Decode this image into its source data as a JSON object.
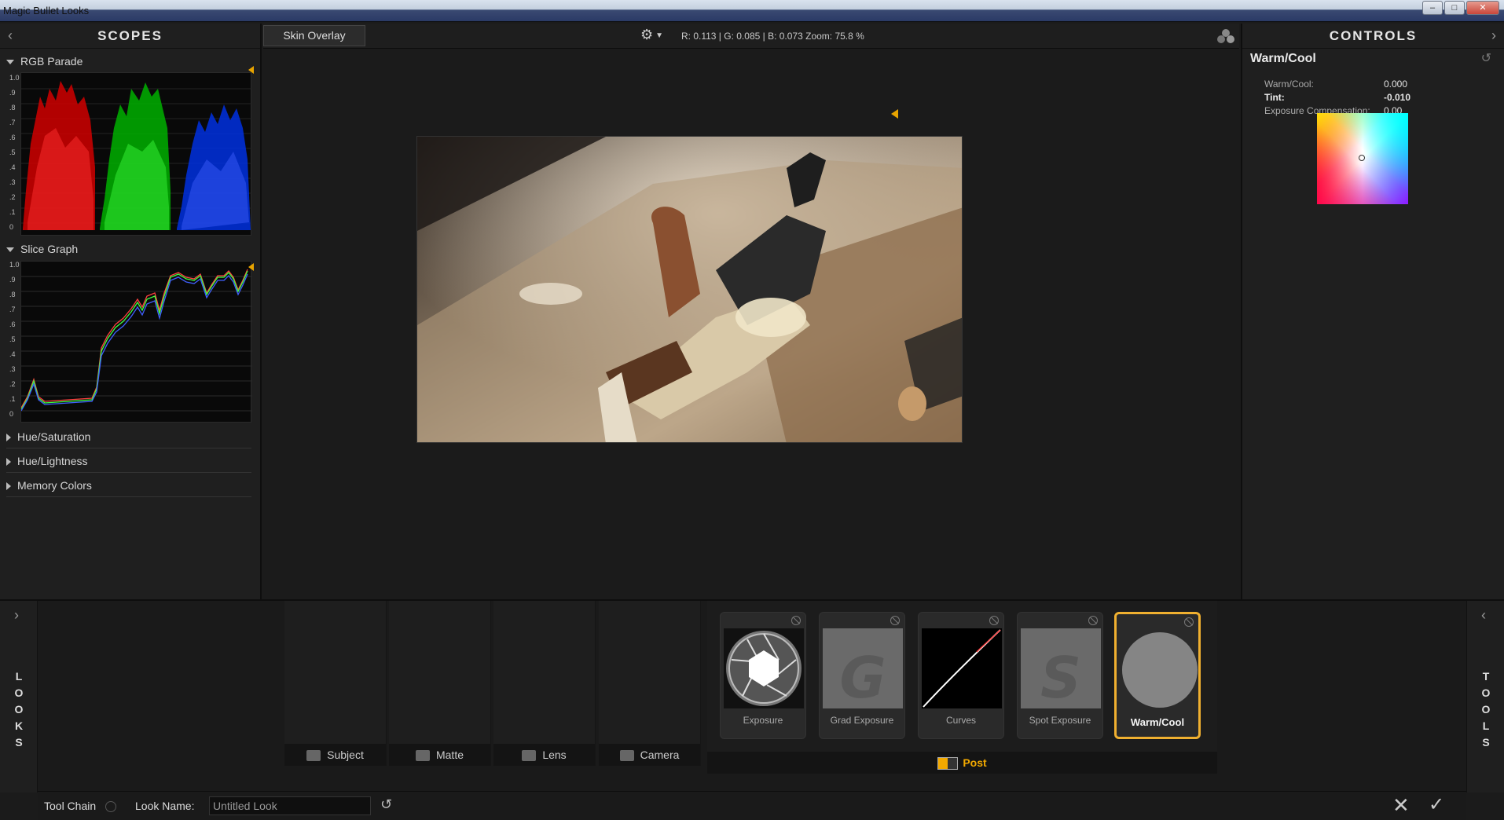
{
  "window": {
    "title": "Magic Bullet Looks"
  },
  "left_panel": {
    "header": "SCOPES",
    "sections": [
      {
        "label": "RGB Parade",
        "expanded": true
      },
      {
        "label": "Slice Graph",
        "expanded": true
      },
      {
        "label": "Hue/Saturation",
        "expanded": false
      },
      {
        "label": "Hue/Lightness",
        "expanded": false
      },
      {
        "label": "Memory Colors",
        "expanded": false
      }
    ],
    "scale_labels": [
      "1.0",
      ".9",
      ".8",
      ".7",
      ".6",
      ".5",
      ".4",
      ".3",
      ".2",
      ".1",
      "0"
    ]
  },
  "center": {
    "skin_overlay": "Skin Overlay",
    "readout": "R: 0.113 | G: 0.085 | B: 0.073    Zoom:  75.8 %"
  },
  "right_panel": {
    "header": "CONTROLS",
    "tool_title": "Warm/Cool",
    "params": [
      {
        "label": "Warm/Cool:",
        "value": "0.000",
        "bold": false
      },
      {
        "label": "Tint:",
        "value": "-0.010",
        "bold": true
      },
      {
        "label": "Exposure Compensation:",
        "value": "0.00",
        "bold": false
      }
    ]
  },
  "bottom": {
    "looks_label": "LOOKS",
    "tools_label": "TOOLS",
    "slots": [
      "Subject",
      "Matte",
      "Lens",
      "Camera"
    ],
    "post_label": "Post",
    "tools": [
      {
        "name": "Exposure",
        "icon": "aperture-icon",
        "active": false
      },
      {
        "name": "Grad Exposure",
        "icon": "grad-exposure-icon",
        "active": false
      },
      {
        "name": "Curves",
        "icon": "curves-icon",
        "active": false
      },
      {
        "name": "Spot Exposure",
        "icon": "spot-exposure-icon",
        "active": false
      },
      {
        "name": "Warm/Cool",
        "icon": "warm-cool-icon",
        "active": true
      }
    ]
  },
  "bottombar": {
    "tool_chain": "Tool Chain",
    "look_name_label": "Look Name:",
    "look_name_value": "Untitled Look"
  },
  "colors": {
    "accent": "#f0b030",
    "post_text": "#f2a900"
  }
}
